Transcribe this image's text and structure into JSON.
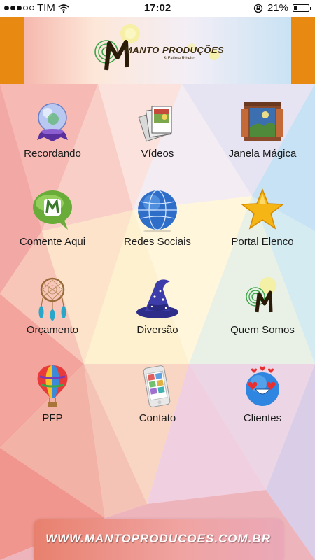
{
  "status_bar": {
    "carrier": "TIM",
    "time": "17:02",
    "battery_percent": "21%",
    "battery_level": 0.21,
    "signal_bars_filled": 3,
    "signal_bars_total": 5,
    "icons": [
      "wifi-icon",
      "orientation-lock-icon",
      "battery-icon"
    ]
  },
  "header": {
    "logo_title": "MANTO PRODUÇÕES",
    "logo_subtitle": "& Fatima Ribeiro",
    "accent_color": "#e88a12"
  },
  "menu": [
    {
      "label": "Recordando",
      "icon": "crystal-ball-icon"
    },
    {
      "label": "Vídeos",
      "icon": "photo-stack-icon"
    },
    {
      "label": "Janela Mágica",
      "icon": "magic-window-icon"
    },
    {
      "label": "Comente Aqui",
      "icon": "speech-bubble-icon"
    },
    {
      "label": "Redes Sociais",
      "icon": "globe-icon"
    },
    {
      "label": "Portal Elenco",
      "icon": "star-icon"
    },
    {
      "label": "Orçamento",
      "icon": "dreamcatcher-icon"
    },
    {
      "label": "Diversão",
      "icon": "wizard-hat-icon"
    },
    {
      "label": "Quem Somos",
      "icon": "manto-logo-icon"
    },
    {
      "label": "PFP",
      "icon": "hot-air-balloon-icon"
    },
    {
      "label": "Contato",
      "icon": "smartphone-icon"
    },
    {
      "label": "Clientes",
      "icon": "love-emoji-icon"
    }
  ],
  "footer": {
    "url": "WWW.MANTOPRODUCOES.COM.BR"
  }
}
